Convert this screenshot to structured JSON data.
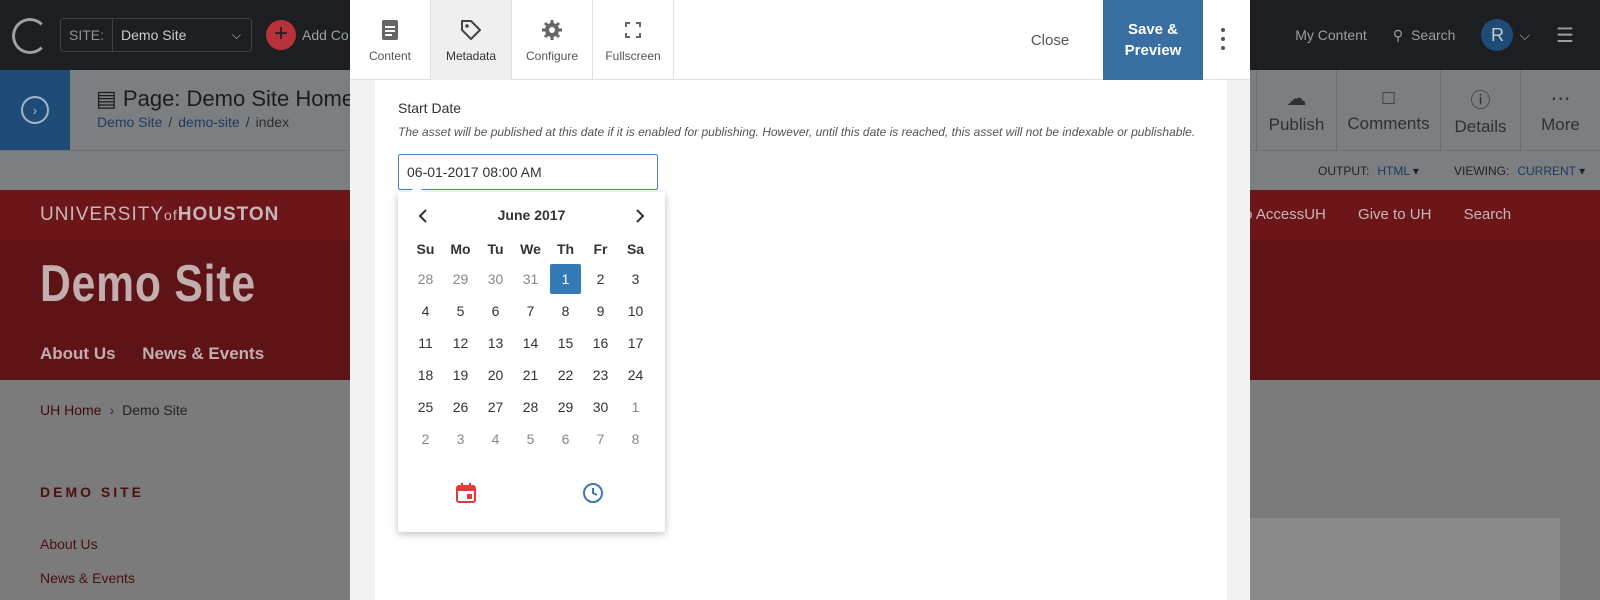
{
  "topbar": {
    "site_label": "SITE:",
    "site_value": "Demo Site",
    "add_content": "Add Co",
    "my_content": "My Content",
    "search": "Search",
    "avatar_initial": "R"
  },
  "page": {
    "title": "Page: Demo Site Home",
    "breadcrumb": [
      "Demo Site",
      "demo-site",
      "index"
    ],
    "actions": [
      {
        "label": "Publish",
        "icon": "cloud-check-icon"
      },
      {
        "label": "Comments",
        "icon": "comment-icon"
      },
      {
        "label": "Details",
        "icon": "info-icon"
      },
      {
        "label": "More",
        "icon": "more-icon"
      }
    ],
    "output_label": "OUTPUT:",
    "output_value": "HTML",
    "viewing_label": "VIEWING:",
    "viewing_value": "CURRENT"
  },
  "site": {
    "university": "UNIVERSITY",
    "of": "of",
    "houston": "HOUSTON",
    "red_links": [
      "to AccessUH",
      "Give to UH",
      "Search"
    ],
    "name": "Demo Site",
    "nav": [
      "About Us",
      "News & Events"
    ],
    "crumb_home": "UH Home",
    "crumb_current": "Demo Site",
    "section_heading": "DEMO SITE",
    "side_links": [
      "About Us",
      "News & Events"
    ]
  },
  "modal": {
    "tabs": [
      {
        "label": "Content",
        "icon": "document-icon"
      },
      {
        "label": "Metadata",
        "icon": "tag-icon"
      },
      {
        "label": "Configure",
        "icon": "gear-icon"
      },
      {
        "label": "Fullscreen",
        "icon": "fullscreen-icon"
      }
    ],
    "active_tab": "Metadata",
    "close": "Close",
    "save_line1": "Save &",
    "save_line2": "Preview",
    "field_label": "Start Date",
    "field_help": "The asset will be published at this date if it is enabled for publishing. However, until this date is reached, this asset will not be indexable or publishable.",
    "field_value": "06-01-2017 08:00 AM"
  },
  "calendar": {
    "month": "June 2017",
    "weekdays": [
      "Su",
      "Mo",
      "Tu",
      "We",
      "Th",
      "Fr",
      "Sa"
    ],
    "weeks": [
      [
        "28",
        "29",
        "30",
        "31",
        "1",
        "2",
        "3"
      ],
      [
        "4",
        "5",
        "6",
        "7",
        "8",
        "9",
        "10"
      ],
      [
        "11",
        "12",
        "13",
        "14",
        "15",
        "16",
        "17"
      ],
      [
        "18",
        "19",
        "20",
        "21",
        "22",
        "23",
        "24"
      ],
      [
        "25",
        "26",
        "27",
        "28",
        "29",
        "30",
        "1"
      ],
      [
        "2",
        "3",
        "4",
        "5",
        "6",
        "7",
        "8"
      ]
    ],
    "muted_first_week_count": 4,
    "muted_last_from_week": 4,
    "selected_day": "1",
    "colors": {
      "selected": "#337ab7",
      "calendar_icon": "#e03c3c",
      "clock_icon": "#3a79b8"
    }
  }
}
